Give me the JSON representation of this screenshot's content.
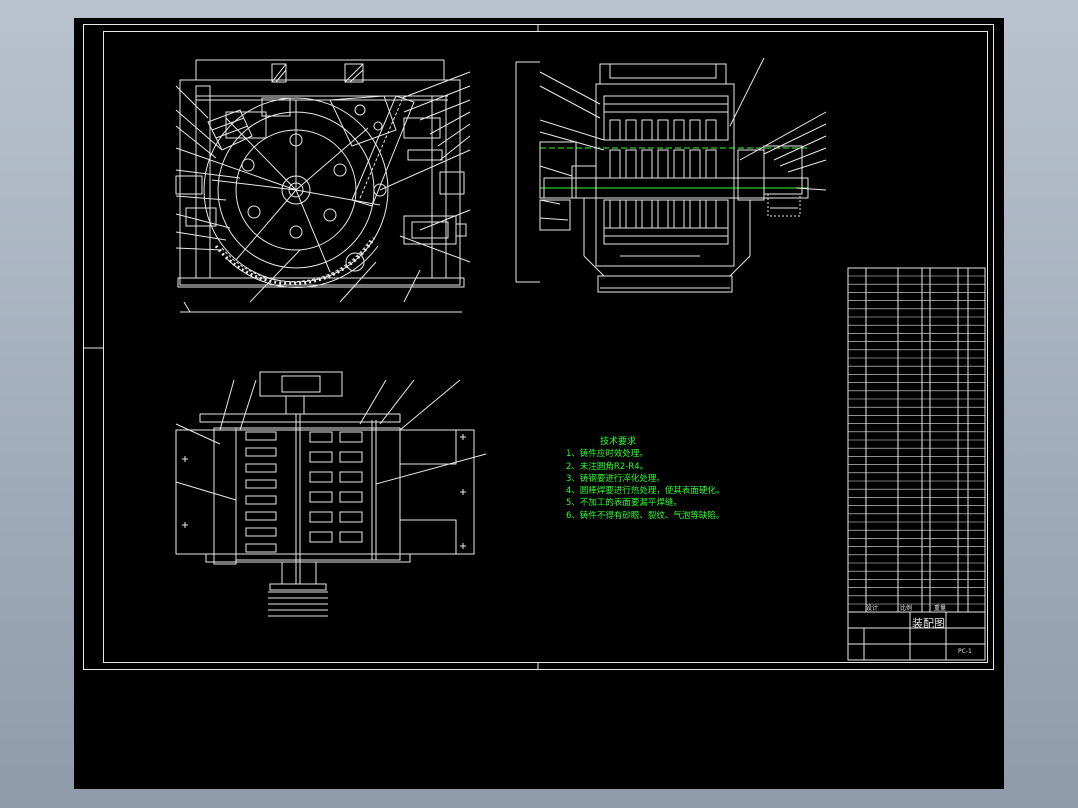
{
  "technical_requirements": {
    "title": "技术要求",
    "items": [
      "1、铸件应时效处理。",
      "2、未注圆角R2-R4。",
      "3、铸钢要进行淬化处理。",
      "4、圆棒焊要进行热处理，使其表面硬化。",
      "5、不加工的表面要漏平焊缝。",
      "6、铸件不得有砂眼、裂纹、气泡等缺陷。"
    ]
  },
  "title_block": {
    "drawing_title": "装配图",
    "drawing_no": "PC-1",
    "design_label": "设计",
    "scale_label": "比例",
    "mass_label": "重量"
  },
  "colors": {
    "background": "#000000",
    "lines": "#e8e8e8",
    "text_green": "#2cff2c",
    "outer_gradient_top": "#b9c3cf"
  }
}
